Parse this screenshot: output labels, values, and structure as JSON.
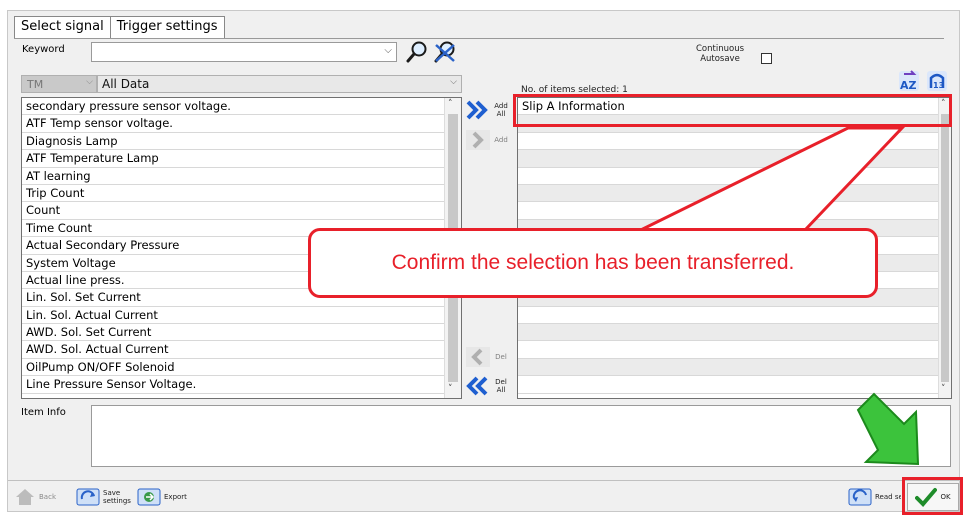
{
  "tabs": [
    "Select signal",
    "Trigger settings"
  ],
  "keyword": {
    "label": "Keyword",
    "value": ""
  },
  "autosave": {
    "label_line1": "Continuous",
    "label_line2": "Autosave"
  },
  "filter": {
    "system": "TM",
    "category": "All Data"
  },
  "signals": [
    "secondary pressure sensor voltage.",
    "ATF Temp sensor voltage.",
    "Diagnosis Lamp",
    "ATF Temperature Lamp",
    "AT learning",
    "Trip Count",
    "Count",
    "Time Count",
    "Actual Secondary Pressure",
    "System Voltage",
    "Actual line press.",
    "Lin. Sol. Set Current",
    "Lin. Sol. Actual Current",
    "AWD. Sol. Set Current",
    "AWD. Sol. Actual Current",
    "OilPump ON/OFF Solenoid",
    "Line Pressure Sensor Voltage."
  ],
  "buttons": {
    "add_all": "Add All",
    "add": "Add",
    "del": "Del",
    "del_all": "Del All",
    "back": "Back",
    "save": "Save settings",
    "export": "Export",
    "read": "Read settings",
    "ok": "OK"
  },
  "selected_header": "No. of items selected: 1",
  "selected": [
    "Slip A Information"
  ],
  "item_info_label": "Item Info",
  "callout_text": "Confirm the selection has been transferred.",
  "colors": {
    "annotation": "#e8202a",
    "arrow": "#3cc33c",
    "accent_blue": "#2a62c8"
  }
}
